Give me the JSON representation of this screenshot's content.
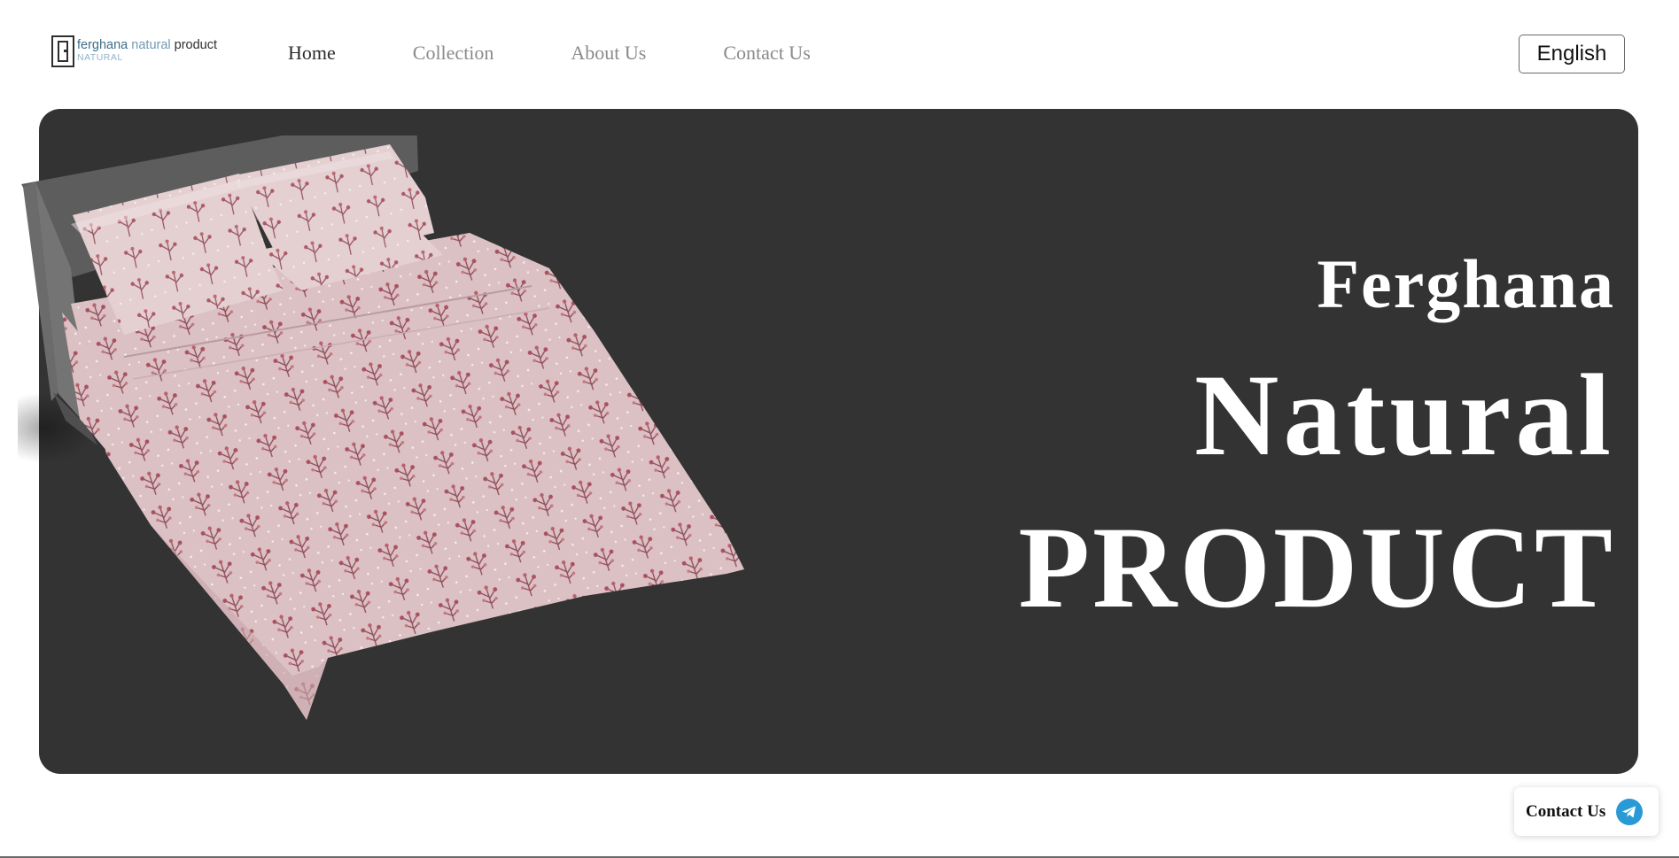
{
  "brand": {
    "logo_word1": "ferghana",
    "logo_word2": "natural",
    "logo_word3": "product",
    "logo_sub": "NATURAL",
    "colors": {
      "dark_blue": "#3d6f8a",
      "light_blue": "#6f9ab4"
    }
  },
  "nav": {
    "items": [
      {
        "label": "Home",
        "active": true
      },
      {
        "label": "Collection",
        "active": false
      },
      {
        "label": "About Us",
        "active": false
      },
      {
        "label": "Contact Us",
        "active": false
      }
    ]
  },
  "language": {
    "selected": "English"
  },
  "hero": {
    "line1": "Ferghana",
    "line2": "Natural",
    "line3": "PRODUCT",
    "background": "#333333",
    "image": "bed-with-pink-floral-bedding"
  },
  "floating_contact": {
    "label": "Contact Us",
    "icon": "telegram-icon",
    "icon_color": "#2a9ad6"
  }
}
